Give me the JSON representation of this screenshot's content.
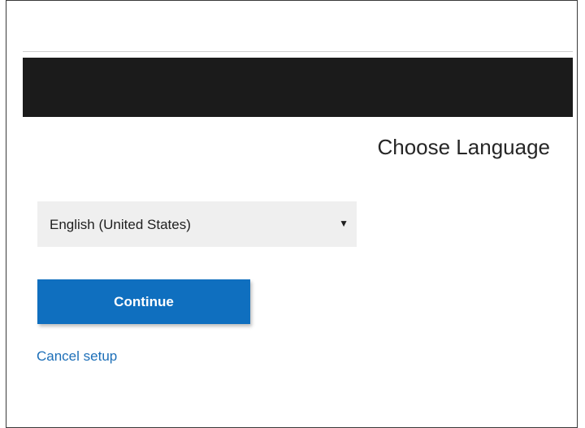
{
  "page": {
    "title": "Choose Language"
  },
  "language_select": {
    "selected": "English (United States)",
    "chevron_icon": "triangle-down"
  },
  "actions": {
    "continue_label": "Continue",
    "cancel_label": "Cancel setup"
  },
  "colors": {
    "header_bar": "#1b1b1b",
    "primary_button": "#0f6fbf",
    "link": "#1d6fb8",
    "select_background": "#efefef"
  }
}
